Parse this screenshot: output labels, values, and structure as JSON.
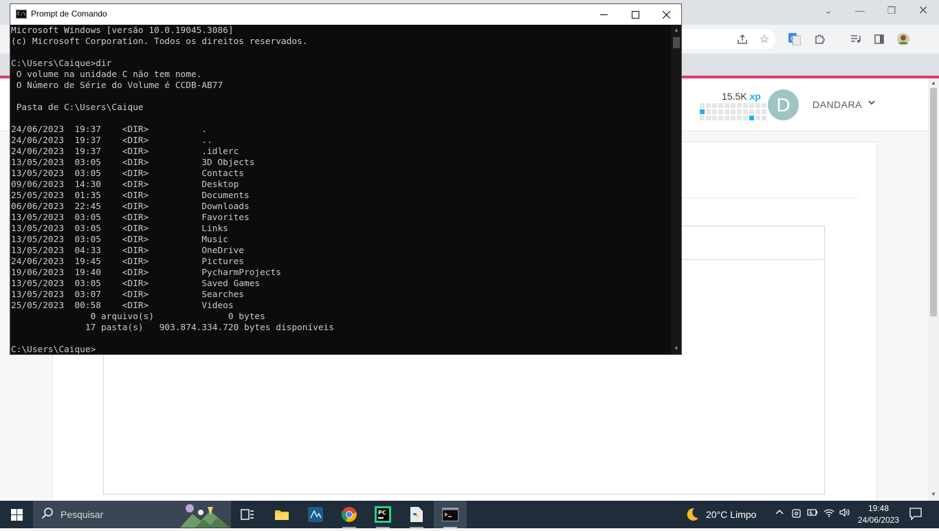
{
  "cmd": {
    "title": "Prompt de Comando",
    "icon_label": "C:\\_",
    "lines": [
      "Microsoft Windows [versão 10.0.19045.3086]",
      "(c) Microsoft Corporation. Todos os direitos reservados.",
      "",
      "C:\\Users\\Caique>dir",
      " O volume na unidade C não tem nome.",
      " O Número de Série do Volume é CCDB-AB77",
      "",
      " Pasta de C:\\Users\\Caique",
      "",
      "24/06/2023  19:37    <DIR>          .",
      "24/06/2023  19:37    <DIR>          ..",
      "24/06/2023  19:37    <DIR>          .idlerc",
      "13/05/2023  03:05    <DIR>          3D Objects",
      "13/05/2023  03:05    <DIR>          Contacts",
      "09/06/2023  14:30    <DIR>          Desktop",
      "25/05/2023  01:35    <DIR>          Documents",
      "06/06/2023  22:45    <DIR>          Downloads",
      "13/05/2023  03:05    <DIR>          Favorites",
      "13/05/2023  03:05    <DIR>          Links",
      "13/05/2023  03:05    <DIR>          Music",
      "13/05/2023  04:33    <DIR>          OneDrive",
      "24/06/2023  19:45    <DIR>          Pictures",
      "19/06/2023  19:40    <DIR>          PycharmProjects",
      "13/05/2023  03:05    <DIR>          Saved Games",
      "13/05/2023  03:07    <DIR>          Searches",
      "25/05/2023  00:58    <DIR>          Videos",
      "               0 arquivo(s)              0 bytes",
      "              17 pasta(s)   903.874.334.720 bytes disponíveis",
      "",
      "C:\\Users\\Caique>"
    ]
  },
  "site": {
    "xp_value": "15.5K",
    "xp_unit": "xp",
    "avatar_letter": "D",
    "username": "DANDARA"
  },
  "taskbar": {
    "search_placeholder": "Pesquisar",
    "weather": "20°C  Limpo",
    "time": "19:48",
    "date": "24/06/2023"
  },
  "colors": {
    "accent_pink": "#e23a6b",
    "xp_blue": "#1cb0f6",
    "taskbar": "#1f2c3a"
  }
}
